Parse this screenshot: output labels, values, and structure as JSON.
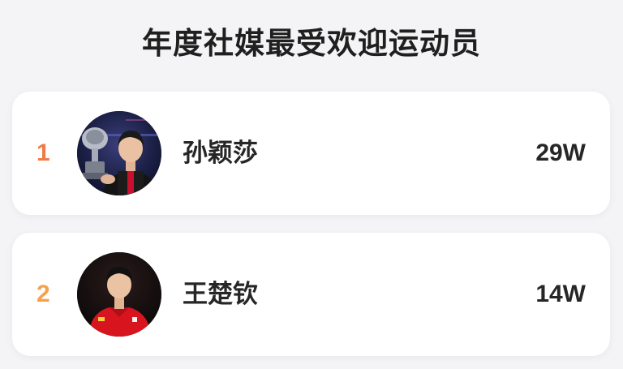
{
  "header": {
    "title": "年度社媒最受欢迎运动员"
  },
  "ranking": [
    {
      "rank": "1",
      "name": "孙颖莎",
      "score": "29W",
      "rank_color": "#f07c4c",
      "avatar_icon": "athlete-with-trophy-photo"
    },
    {
      "rank": "2",
      "name": "王楚钦",
      "score": "14W",
      "rank_color": "#f5a24a",
      "avatar_icon": "athlete-red-jersey-photo"
    }
  ]
}
